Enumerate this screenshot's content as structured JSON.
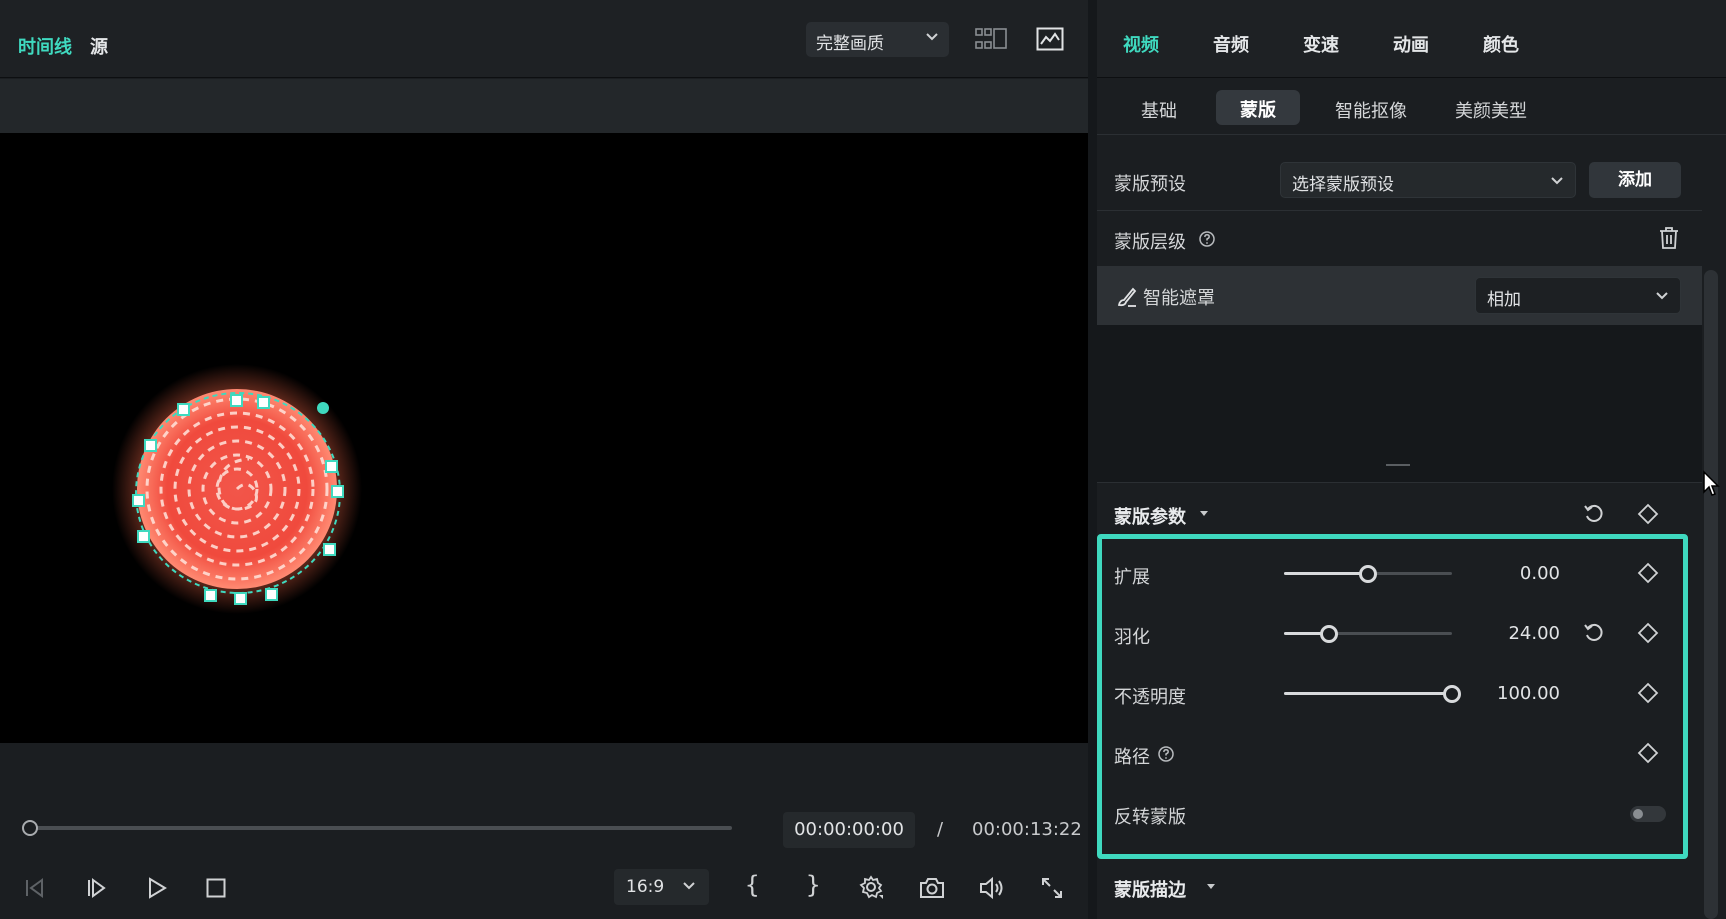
{
  "left_panel": {
    "tabs": {
      "timeline": "时间线",
      "source": "源"
    },
    "quality_select": {
      "value": "完整画质"
    },
    "timecode": {
      "current": "00:00:00:00",
      "separator": "/",
      "total": "00:00:13:22"
    },
    "aspect_ratio": {
      "value": "16:9"
    },
    "braces": {
      "open": "{",
      "close": "}"
    },
    "playback_progress": 0.0
  },
  "right_panel": {
    "main_tabs": [
      "视频",
      "音频",
      "变速",
      "动画",
      "颜色"
    ],
    "active_main_tab": "视频",
    "sub_tabs": [
      "基础",
      "蒙版",
      "智能抠像",
      "美颜美型"
    ],
    "active_sub_tab": "蒙版",
    "mask_preset": {
      "label": "蒙版预设",
      "placeholder": "选择蒙版预设",
      "add_label": "添加"
    },
    "mask_level": {
      "label": "蒙版层级"
    },
    "smart_mask": {
      "label": "智能遮罩",
      "blend_mode": "相加"
    },
    "mask_params": {
      "title": "蒙版参数",
      "expand": {
        "label": "扩展",
        "value": "0.00",
        "slider_fraction": 0.5
      },
      "feather": {
        "label": "羽化",
        "value": "24.00",
        "slider_fraction": 0.27
      },
      "opacity": {
        "label": "不透明度",
        "value": "100.00",
        "slider_fraction": 1.0
      },
      "path": {
        "label": "路径"
      },
      "invert": {
        "label": "反转蒙版",
        "enabled": false
      }
    },
    "mask_stroke": {
      "title": "蒙版描边"
    }
  },
  "colors": {
    "accent": "#3fd9bf",
    "background": "#1b1e21",
    "canvas": "#000000"
  }
}
